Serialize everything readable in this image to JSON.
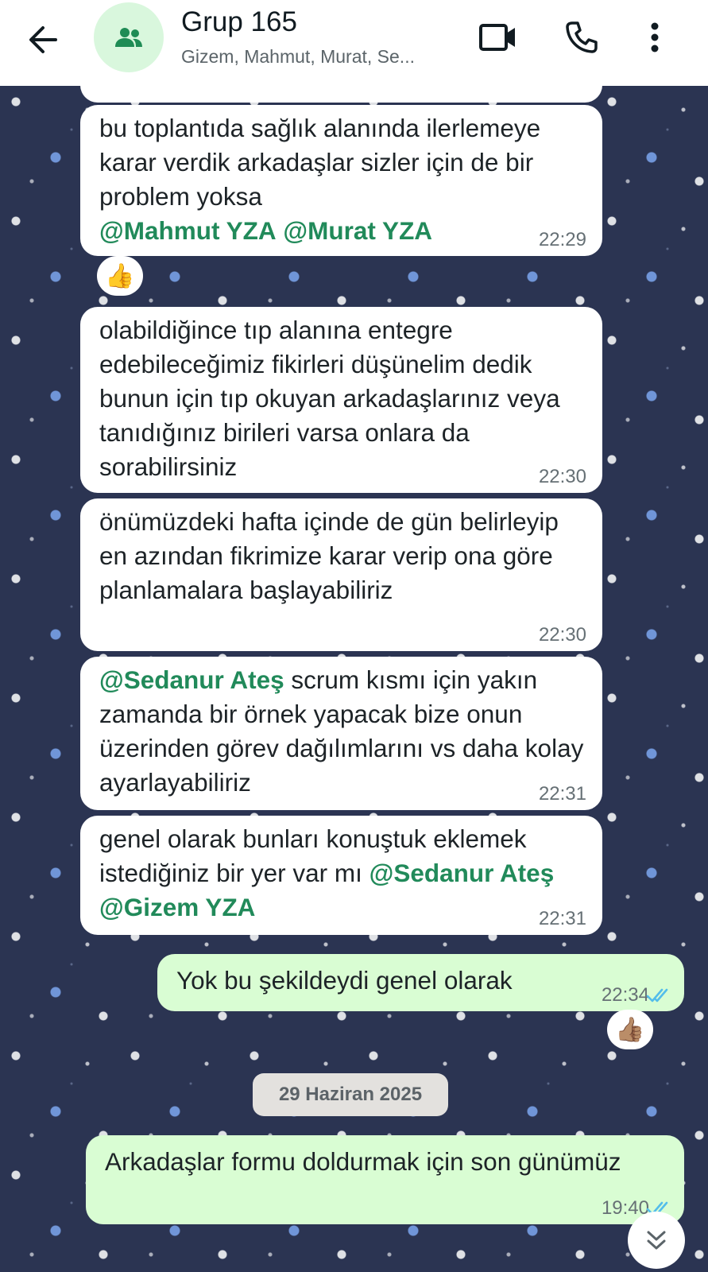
{
  "header": {
    "title": "Grup 165",
    "subtitle": "Gizem, Mahmut, Murat, Se...",
    "icons": [
      "back-arrow-icon",
      "group-icon",
      "video-call-icon",
      "phone-icon",
      "more-vert-icon"
    ]
  },
  "messages": [
    {
      "direction": "in",
      "text": "bu toplantıda sağlık alanında ilerlemeye karar verdik arkadaşlar sizler için de bir problem yoksa",
      "mentions": [
        "@Mahmut YZA",
        "@Murat YZA"
      ],
      "time": "22:29",
      "reaction": "👍"
    },
    {
      "direction": "in",
      "text": "olabildiğince tıp alanına entegre edebileceğimiz fikirleri düşünelim dedik bunun için tıp okuyan arkadaşlarınız veya tanıdığınız birileri varsa onlara da sorabilirsiniz",
      "time": "22:30"
    },
    {
      "direction": "in",
      "text": "önümüzdeki hafta içinde de gün belirleyip en azından fikrimize karar verip ona göre planlamalara başlayabiliriz",
      "time": "22:30"
    },
    {
      "direction": "in",
      "mention_lead": "@Sedanur Ateş",
      "text": " scrum kısmı için yakın zamanda bir örnek yapacak bize onun üzerinden görev dağılımlarını vs daha kolay ayarlayabiliriz",
      "time": "22:31"
    },
    {
      "direction": "in",
      "text": "genel olarak bunları konuştuk eklemek istediğiniz bir yer var mı ",
      "mentions": [
        "@Sedanur Ateş",
        "@Gizem YZA"
      ],
      "time": "22:31"
    },
    {
      "direction": "out",
      "text": "Yok bu şekildeydi genel olarak",
      "time": "22:34",
      "reaction": "👍🏽",
      "status": "read"
    },
    {
      "direction": "out",
      "text": "Arkadaşlar formu doldurmak için son günümüz",
      "time": "19:40",
      "status": "read"
    }
  ],
  "date_separator": "29 Haziran 2025",
  "colors": {
    "header_bg": "#ffffff",
    "incoming_bubble": "#ffffff",
    "outgoing_bubble": "#d9fdd3",
    "mention": "#218a5a",
    "read_ticks": "#53bdeb",
    "wallpaper": "#2b3452"
  }
}
